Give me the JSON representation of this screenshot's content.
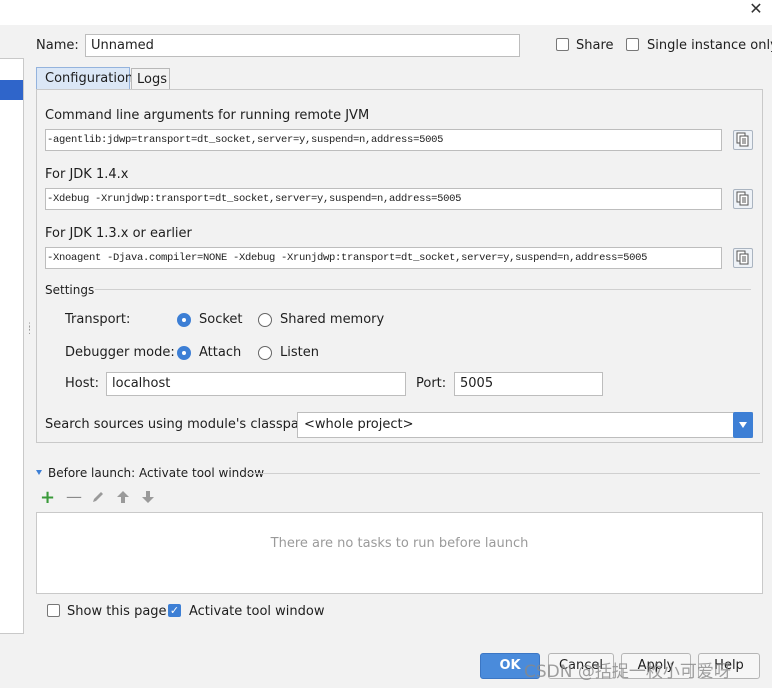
{
  "window": {
    "close_symbol": "✕"
  },
  "name_row": {
    "label": "Name:",
    "value": "Unnamed",
    "share_label": "Share",
    "share_checked": false,
    "single_instance_label": "Single instance only",
    "single_instance_checked": false
  },
  "tabs": [
    {
      "label": "Configuration",
      "active": true
    },
    {
      "label": "Logs",
      "active": false
    }
  ],
  "jvm_args": [
    {
      "label": "Command line arguments for running remote JVM",
      "value": "-agentlib:jdwp=transport=dt_socket,server=y,suspend=n,address=5005"
    },
    {
      "label": "For JDK 1.4.x",
      "value": "-Xdebug -Xrunjdwp:transport=dt_socket,server=y,suspend=n,address=5005"
    },
    {
      "label": "For JDK 1.3.x or earlier",
      "value": "-Xnoagent -Djava.compiler=NONE -Xdebug -Xrunjdwp:transport=dt_socket,server=y,suspend=n,address=5005"
    }
  ],
  "settings": {
    "title": "Settings",
    "transport_label": "Transport:",
    "transport_options": [
      "Socket",
      "Shared memory"
    ],
    "transport_selected": "Socket",
    "debugger_mode_label": "Debugger mode:",
    "debugger_mode_options": [
      "Attach",
      "Listen"
    ],
    "debugger_mode_selected": "Attach",
    "host_label": "Host:",
    "host_value": "localhost",
    "port_label": "Port:",
    "port_value": "5005"
  },
  "classpath": {
    "label": "Search sources using module's classpath:",
    "value": "<whole project>"
  },
  "before_launch": {
    "title": "Before launch: Activate tool window",
    "empty_text": "There are no tasks to run before launch",
    "toolbar_icons": [
      "add-icon",
      "remove-icon",
      "edit-icon",
      "move-up-icon",
      "move-down-icon"
    ]
  },
  "options": {
    "show_page_label": "Show this page",
    "show_page_checked": false,
    "activate_tool_label": "Activate tool window",
    "activate_tool_checked": true
  },
  "buttons": {
    "ok": "OK",
    "cancel": "Cancel",
    "apply": "Apply",
    "help": "Help"
  },
  "watermark": "CSDN @括捉一枚小可爱呀",
  "colors": {
    "accent": "#3d7fd5",
    "selection": "#2f65ca",
    "add_green": "#3a9a3a"
  }
}
